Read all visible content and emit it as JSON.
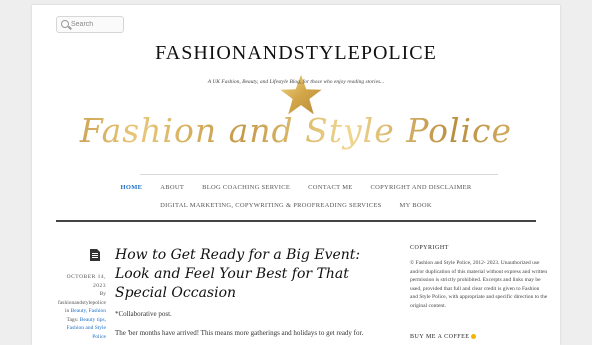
{
  "search": {
    "placeholder": "Search"
  },
  "header": {
    "site_title": "FASHIONANDSTYLEPOLICE",
    "tagline": "A UK Fashion, Beauty, and Lifestyle Blog, for those who enjoy reading stories...",
    "script_title": "Fashion and Style Police",
    "star_color": "#d9b04f"
  },
  "nav": {
    "row1": [
      {
        "label": "HOME",
        "active": true
      },
      {
        "label": "ABOUT"
      },
      {
        "label": "BLOG COACHING SERVICE"
      },
      {
        "label": "CONTACT ME"
      },
      {
        "label": "COPYRIGHT AND DISCLAIMER"
      }
    ],
    "row2": [
      {
        "label": "DIGITAL MARKETING, COPYWRITING & PROOFREADING SERVICES"
      },
      {
        "label": "MY BOOK"
      }
    ],
    "active_color": "#1e6fc7"
  },
  "post": {
    "date": "October 14, 2023",
    "by": "By",
    "author": "fashionandstylepolice",
    "in": "in",
    "categories": "Beauty, Fashion",
    "tags_label": "Tags:",
    "tags": "Beauty tips, Fashion and Style Police",
    "title": "How to Get Ready for a Big Event: Look and Feel Your Best for That Special Occasion",
    "p1": "*Collaborative post.",
    "p2": "The 'ber months have arrived! This means more gatherings and holidays to get ready for."
  },
  "sidebar": {
    "heading": "COPYRIGHT",
    "text": "© Fashion and Style Police, 2012- 2023. Unauthorized use and/or duplication of this material without express and written permission is strictly prohibited. Excerpts and links may be used, provided that full and clear credit is given to Fashion and Style Police, with appropriate and specific direction to the original content.",
    "heading2": "BUY ME A COFFEE"
  }
}
